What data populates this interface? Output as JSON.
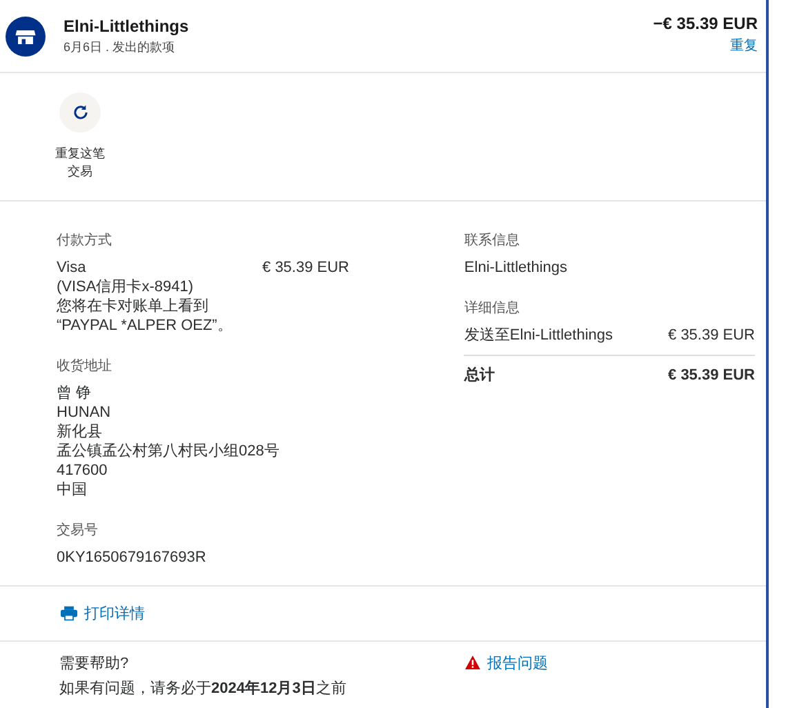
{
  "header": {
    "merchant": "Elni-Littlethings",
    "subtitle": "6月6日 . 发出的款项",
    "amount": "−€ 35.39 EUR",
    "repeat_link": "重复"
  },
  "repeat_action": {
    "label": "重复这笔交易"
  },
  "payment": {
    "heading": "付款方式",
    "method": "Visa",
    "amount": "€ 35.39 EUR",
    "lines": [
      "(VISA信用卡x-8941)",
      "您将在卡对账单上看到",
      "“PAYPAL *ALPER OEZ”。"
    ]
  },
  "shipping": {
    "heading": "收货地址",
    "lines": [
      "曾 铮",
      "HUNAN",
      "新化县",
      "孟公镇孟公村第八村民小组028号",
      "417600",
      "中国"
    ]
  },
  "transaction": {
    "heading": "交易号",
    "id": "0KY1650679167693R"
  },
  "contact": {
    "heading": "联系信息",
    "name": "Elni-Littlethings"
  },
  "details": {
    "heading": "详细信息",
    "rows": [
      {
        "label": "发送至Elni-Littlethings",
        "amount": "€ 35.39 EUR"
      }
    ],
    "total_label": "总计",
    "total": "€ 35.39 EUR"
  },
  "print_link": "打印详情",
  "help": {
    "heading": "需要帮助?",
    "text": "如果有问题，请务必于**2024年12月3日**之前",
    "report_link": "报告问题"
  }
}
